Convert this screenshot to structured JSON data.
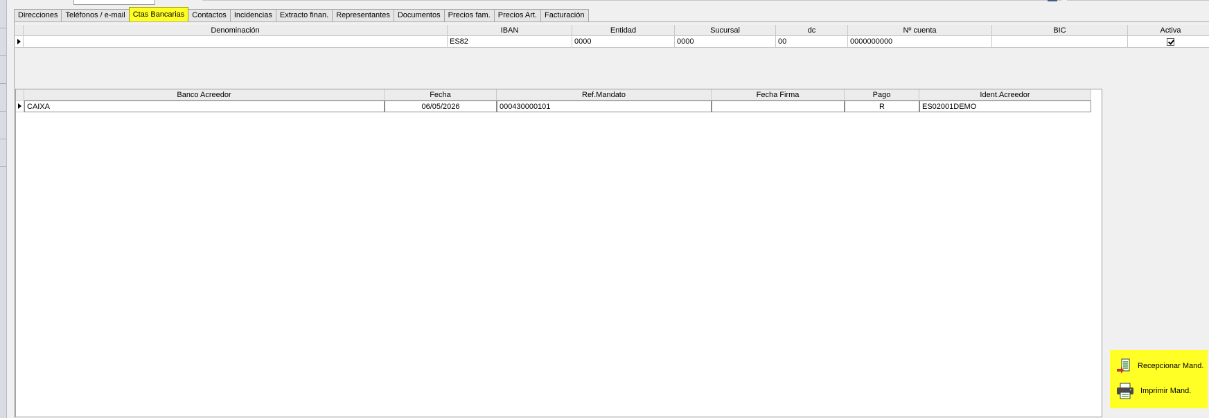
{
  "tabs": [
    {
      "label": "Direcciones"
    },
    {
      "label": "Teléfonos / e-mail"
    },
    {
      "label": "Ctas Bancarias",
      "active": true
    },
    {
      "label": "Contactos"
    },
    {
      "label": "Incidencias"
    },
    {
      "label": "Extracto finan."
    },
    {
      "label": "Representantes"
    },
    {
      "label": "Documentos"
    },
    {
      "label": "Precios fam."
    },
    {
      "label": "Precios Art."
    },
    {
      "label": "Facturación"
    }
  ],
  "accounts_grid": {
    "headers": [
      "Denominación",
      "IBAN",
      "Entidad",
      "Sucursal",
      "dc",
      "Nº cuenta",
      "BIC",
      "Activa"
    ],
    "rows": [
      {
        "denominacion": "",
        "iban": "ES82",
        "entidad": "0000",
        "sucursal": "0000",
        "dc": "00",
        "cuenta": "0000000000",
        "bic": "",
        "activa": true
      }
    ]
  },
  "mandates_grid": {
    "headers": [
      "Banco Acreedor",
      "Fecha",
      "Ref.Mandato",
      "Fecha Firma",
      "Pago",
      "Ident.Acreedor"
    ],
    "rows": [
      {
        "banco": "CAIXA",
        "fecha": "06/05/2026",
        "ref": "000430000101",
        "fecha_firma": "",
        "pago": "R",
        "ident": "ES02001DEMO"
      }
    ]
  },
  "actions": {
    "receive_label": "Recepcionar Mand.",
    "print_label": "Imprimir Mand."
  },
  "colors": {
    "highlight": "#ffff26",
    "receive_icon": "#2f8f3a",
    "print_icon": "#4a4a4a"
  },
  "icons": {
    "receive": "receive-mandate-icon",
    "print": "printer-icon"
  }
}
